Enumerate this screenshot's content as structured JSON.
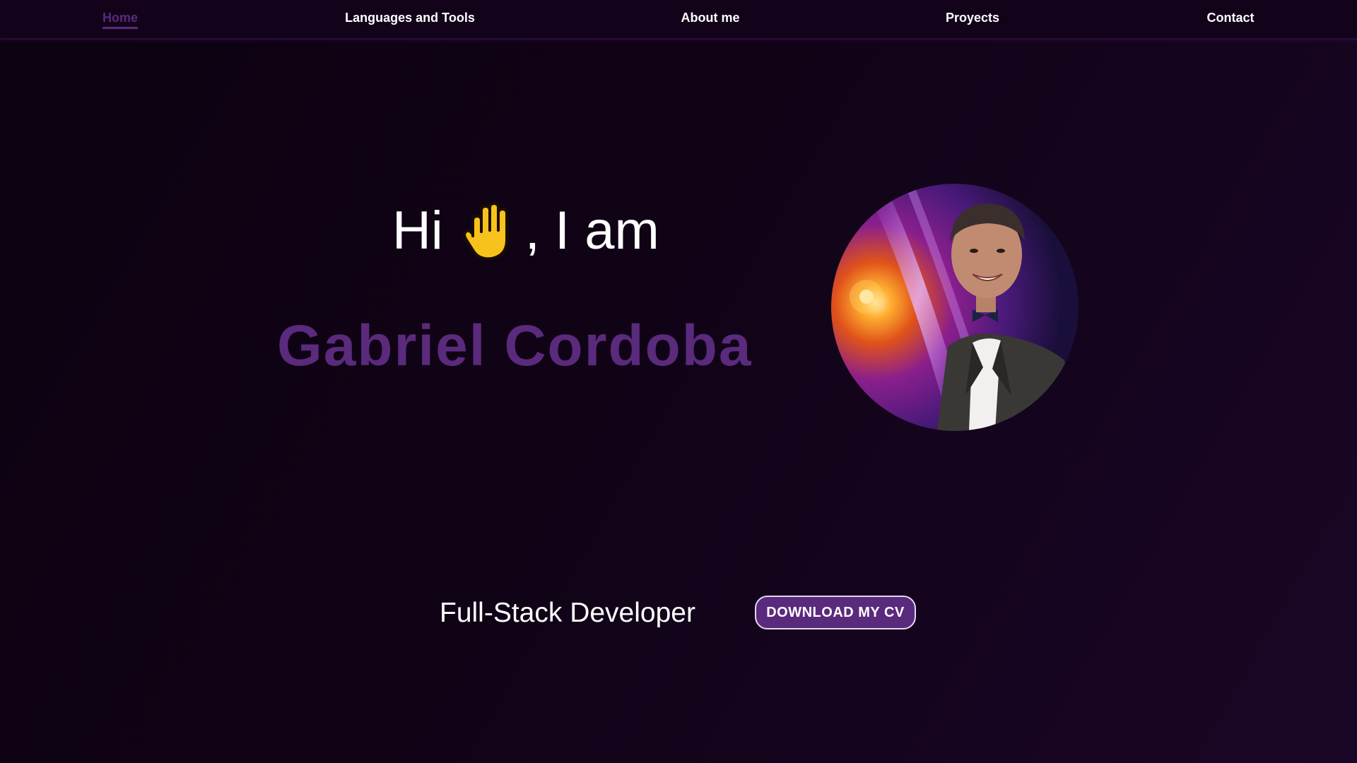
{
  "nav": {
    "items": [
      {
        "label": "Home",
        "active": true
      },
      {
        "label": "Languages and Tools",
        "active": false
      },
      {
        "label": "About me",
        "active": false
      },
      {
        "label": "Proyects",
        "active": false
      },
      {
        "label": "Contact",
        "active": false
      }
    ]
  },
  "hero": {
    "greeting_before": "Hi",
    "greeting_after": ", I am",
    "greeting_icon": "raised-hand-icon",
    "name": "Gabriel Cordoba",
    "role": "Full-Stack Developer",
    "cv_button_label": "DOWNLOAD MY CV",
    "avatar_icon": "profile-photo"
  },
  "colors": {
    "background": "#0e0314",
    "navbar": "#12031a",
    "accent": "#5a2a7c",
    "text": "#ffffff",
    "button_border": "#e6d6f2"
  }
}
